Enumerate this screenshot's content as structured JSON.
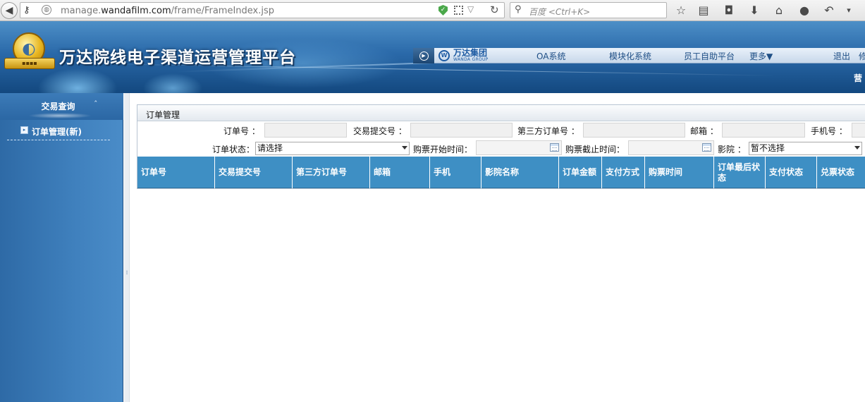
{
  "browser": {
    "url_dim_prefix": "manage.",
    "url_domain": "wandafilm.com",
    "url_path": "/frame/FrameIndex.jsp",
    "search_placeholder": "百度 <Ctrl+K>"
  },
  "icons": {
    "back": "back-arrow-icon",
    "key": "key-icon",
    "globe": "globe-icon",
    "shield": "shield-icon",
    "qr": "qr-code-icon",
    "reload": "reload-icon",
    "search": "search-icon",
    "bookmark": "star-icon",
    "reader": "reader-icon",
    "pocket": "pocket-icon",
    "download": "download-icon",
    "home": "home-icon",
    "chat": "chat-icon",
    "undo": "undo-icon",
    "menu": "chevron-down-icon",
    "calendar": "calendar-icon"
  },
  "banner": {
    "app_title": "万达院线电子渠道运营管理平台",
    "group_name": "万达集团",
    "group_sub": "WANDA GROUP",
    "nav_links": [
      "OA系统",
      "模块化系统",
      "员工自助平台",
      "更多▼",
      "退出",
      "修"
    ],
    "greeting": "营"
  },
  "sidebar": {
    "section_title": "交易查询",
    "collapse_glyph": "ˆ",
    "items": [
      {
        "label": "订单管理(新)"
      }
    ]
  },
  "panel": {
    "title": "订单管理",
    "filters": {
      "order_no": "订单号 ：",
      "txn_no": "交易提交号 ：",
      "third_party_no": "第三方订单号 ：",
      "email": "邮箱 ：",
      "phone": "手机号 ：",
      "order_status": "订单状态：",
      "order_status_value": "请选择",
      "start_time": "购票开始时间：",
      "end_time": "购票截止时间：",
      "cinema": "影院 ：",
      "cinema_value": "暂不选择"
    },
    "columns": [
      "订单号",
      "交易提交号",
      "第三方订单号",
      "邮箱",
      "手机",
      "影院名称",
      "订单金额",
      "支付方式",
      "购票时间",
      "订单最后状态",
      "支付状态",
      "兑票状态"
    ]
  },
  "colors": {
    "banner_blue": "#2a69a9",
    "table_header": "#3e8fc4",
    "sidebar_blue": "#3f80bd"
  }
}
